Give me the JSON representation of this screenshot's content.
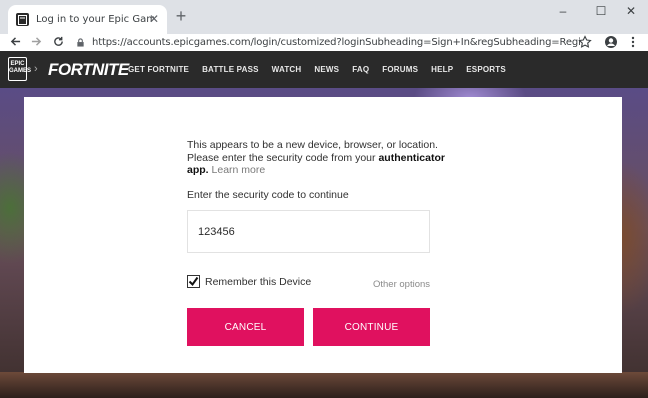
{
  "browser": {
    "tab_title": "Log in to your Epic Games accou",
    "url": "https://accounts.epicgames.com/login/customized?loginSubheading=Sign+In&regSubheading=Register&product...",
    "tab_close": "✕",
    "new_tab": "+",
    "window_controls": [
      "–",
      "☐",
      "✕"
    ]
  },
  "site": {
    "epic_logo": "EPIC GAMES",
    "brand": "FORTNITE",
    "nav_items": [
      "GET FORTNITE",
      "BATTLE PASS",
      "WATCH",
      "NEWS",
      "FAQ",
      "FORUMS",
      "HELP",
      "ESPORTS"
    ]
  },
  "login": {
    "intro_line1": "This appears to be a new device, browser, or location.",
    "intro_line2": "Please enter the security code from your ",
    "intro_bold": "authenticator app.",
    "learn_more": "Learn more",
    "field_label": "Enter the security code to continue",
    "code_value": "123456",
    "remember_label": "Remember this Device",
    "remember_checked": true,
    "other_options": "Other options",
    "cancel": "CANCEL",
    "continue": "CONTINUE"
  },
  "colors": {
    "accent": "#e0115f",
    "site_header": "#2a2a2a"
  }
}
